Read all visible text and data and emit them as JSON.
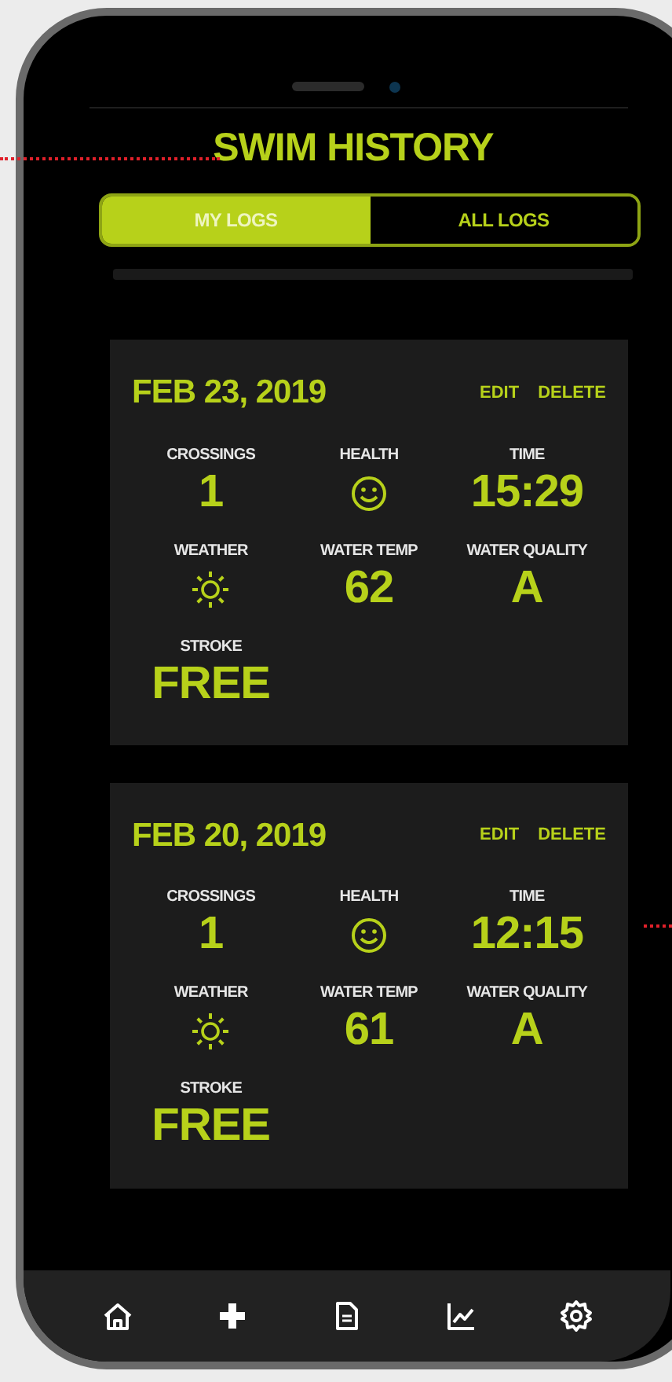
{
  "title": "SWIM HISTORY",
  "tabs": [
    {
      "label": "MY LOGS",
      "selected": true
    },
    {
      "label": "ALL LOGS",
      "selected": false
    }
  ],
  "logs": [
    {
      "date": "FEB 23, 2019",
      "actions": [
        "EDIT",
        "DELETE"
      ],
      "stats": [
        {
          "label": "CROSSINGS",
          "kind": "text",
          "value": "1"
        },
        {
          "label": "HEALTH",
          "kind": "smiley"
        },
        {
          "label": "TIME",
          "kind": "text",
          "value": "15:29"
        },
        {
          "label": "WEATHER",
          "kind": "sun"
        },
        {
          "label": "WATER TEMP",
          "kind": "text",
          "value": "62"
        },
        {
          "label": "WATER QUALITY",
          "kind": "text",
          "value": "A"
        },
        {
          "label": "STROKE",
          "kind": "text",
          "value": "FREE"
        }
      ]
    },
    {
      "date": "FEB 20, 2019",
      "actions": [
        "EDIT",
        "DELETE"
      ],
      "stats": [
        {
          "label": "CROSSINGS",
          "kind": "text",
          "value": "1"
        },
        {
          "label": "HEALTH",
          "kind": "smiley"
        },
        {
          "label": "TIME",
          "kind": "text",
          "value": "12:15"
        },
        {
          "label": "WEATHER",
          "kind": "sun"
        },
        {
          "label": "WATER TEMP",
          "kind": "text",
          "value": "61"
        },
        {
          "label": "WATER QUALITY",
          "kind": "text",
          "value": "A"
        },
        {
          "label": "STROKE",
          "kind": "text",
          "value": "FREE"
        }
      ]
    }
  ]
}
